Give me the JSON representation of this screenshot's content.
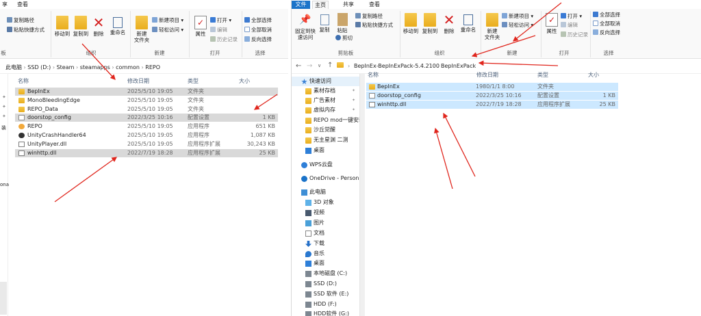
{
  "colors": {
    "accent": "#1a73c9",
    "selection": "#cce8ff",
    "selection_grey": "#d9d9d9",
    "arrow": "#e0261d",
    "folder": "#f0bc3a"
  },
  "left_window": {
    "tabs": [
      "享",
      "查看"
    ],
    "ribbon": {
      "copy_path": "复制路径",
      "paste_shortcut": "粘贴快捷方式",
      "move_to": "移动到",
      "copy_to": "复制到",
      "delete": "删除",
      "rename": "重命名",
      "new_folder": "新建\n文件夹",
      "new_item": "新建项目",
      "easy_access": "轻松访问",
      "properties": "属性",
      "open": "打开",
      "edit": "编辑",
      "history": "历史记录",
      "select_all": "全部选择",
      "select_none": "全部取消",
      "invert_selection": "反向选择",
      "group_clipboard": "板",
      "group_organize": "组织",
      "group_new": "新建",
      "group_open": "打开",
      "group_select": "选择"
    },
    "breadcrumb": [
      "此电脑",
      "SSD (D:)",
      "Steam",
      "steamapps",
      "common",
      "REPO"
    ],
    "columns": [
      "名称",
      "修改日期",
      "类型",
      "大小"
    ],
    "files": [
      {
        "name": "BepInEx",
        "date": "2025/5/10 19:05",
        "type": "文件夹",
        "size": "",
        "icon": "folder-icon",
        "selected": true
      },
      {
        "name": "MonoBleedingEdge",
        "date": "2025/5/10 19:05",
        "type": "文件夹",
        "size": "",
        "icon": "folder-icon",
        "selected": false
      },
      {
        "name": "REPO_Data",
        "date": "2025/5/10 19:05",
        "type": "文件夹",
        "size": "",
        "icon": "folder-icon",
        "selected": false
      },
      {
        "name": "doorstop_config",
        "date": "2022/3/25 10:16",
        "type": "配置设置",
        "size": "1 KB",
        "icon": "config-file-icon",
        "selected": true
      },
      {
        "name": "REPO",
        "date": "2025/5/10 19:05",
        "type": "应用程序",
        "size": "651 KB",
        "icon": "app-icon",
        "selected": false
      },
      {
        "name": "UnityCrashHandler64",
        "date": "2025/5/10 19:05",
        "type": "应用程序",
        "size": "1,087 KB",
        "icon": "unity-icon",
        "selected": false
      },
      {
        "name": "UnityPlayer.dll",
        "date": "2025/5/10 19:05",
        "type": "应用程序扩展",
        "size": "30,243 KB",
        "icon": "dll-icon",
        "selected": false
      },
      {
        "name": "winhttp.dll",
        "date": "2022/7/19 18:28",
        "type": "应用程序扩展",
        "size": "25 KB",
        "icon": "dll-icon",
        "selected": true
      }
    ],
    "nav_fragments": [
      "装",
      "ona"
    ]
  },
  "right_window": {
    "tabs": [
      "文件",
      "主页",
      "共享",
      "查看"
    ],
    "active_tab": "主页",
    "ribbon": {
      "pin_quick": "固定到快\n速访问",
      "copy": "复制",
      "paste": "粘贴",
      "copy_path": "复制路径",
      "paste_shortcut": "粘贴快捷方式",
      "cut": "剪切",
      "move_to": "移动到",
      "copy_to": "复制到",
      "delete": "删除",
      "rename": "重命名",
      "new_folder": "新建\n文件夹",
      "new_item": "新建项目",
      "easy_access": "轻松访问",
      "properties": "属性",
      "open": "打开",
      "edit": "编辑",
      "history": "历史记录",
      "select_all": "全部选择",
      "select_none": "全部取消",
      "invert_selection": "反向选择",
      "group_clipboard": "剪贴板",
      "group_organize": "组织",
      "group_new": "新建",
      "group_open": "打开",
      "group_select": "选择"
    },
    "breadcrumb": [
      "BepInEx-BepInExPack-5.4.2100",
      "BepInExPack"
    ],
    "columns": [
      "名称",
      "修改日期",
      "类型",
      "大小"
    ],
    "files": [
      {
        "name": "BepInEx",
        "date": "1980/1/1 8:00",
        "type": "文件夹",
        "size": "",
        "icon": "folder-icon"
      },
      {
        "name": "doorstop_config",
        "date": "2022/3/25 10:16",
        "type": "配置设置",
        "size": "1 KB",
        "icon": "config-file-icon"
      },
      {
        "name": "winhttp.dll",
        "date": "2022/7/19 18:28",
        "type": "应用程序扩展",
        "size": "25 KB",
        "icon": "dll-icon"
      }
    ],
    "nav": [
      {
        "label": "快速访问",
        "icon": "star-icon",
        "kind": "section",
        "pinned": false
      },
      {
        "label": "素材存档",
        "icon": "folder-icon",
        "kind": "item",
        "pinned": true
      },
      {
        "label": "广告素材",
        "icon": "folder-icon",
        "kind": "item",
        "pinned": true
      },
      {
        "label": "虚拟内存",
        "icon": "folder-icon",
        "kind": "item",
        "pinned": true
      },
      {
        "label": "REPO mod一键安装",
        "icon": "folder-icon",
        "kind": "item",
        "pinned": false
      },
      {
        "label": "沙丘觉醒",
        "icon": "folder-icon",
        "kind": "item",
        "pinned": false
      },
      {
        "label": "无主星渊 二测",
        "icon": "folder-icon",
        "kind": "item",
        "pinned": false
      },
      {
        "label": "桌面",
        "icon": "desktop-icon",
        "kind": "item",
        "pinned": false
      },
      {
        "label": "WPS云盘",
        "icon": "cloud-icon",
        "kind": "section",
        "pinned": false
      },
      {
        "label": "OneDrive - Persona",
        "icon": "onedrive-icon",
        "kind": "section",
        "pinned": false
      },
      {
        "label": "此电脑",
        "icon": "computer-icon",
        "kind": "section",
        "pinned": false
      },
      {
        "label": "3D 对象",
        "icon": "3d-icon",
        "kind": "item",
        "pinned": false
      },
      {
        "label": "视频",
        "icon": "video-icon",
        "kind": "item",
        "pinned": false
      },
      {
        "label": "图片",
        "icon": "picture-icon",
        "kind": "item",
        "pinned": false
      },
      {
        "label": "文档",
        "icon": "document-icon",
        "kind": "item",
        "pinned": false
      },
      {
        "label": "下载",
        "icon": "download-icon",
        "kind": "item",
        "pinned": false
      },
      {
        "label": "音乐",
        "icon": "music-icon",
        "kind": "item",
        "pinned": false
      },
      {
        "label": "桌面",
        "icon": "desktop-icon",
        "kind": "item",
        "pinned": false
      },
      {
        "label": "本地磁盘 (C:)",
        "icon": "drive-icon",
        "kind": "item",
        "pinned": false
      },
      {
        "label": "SSD (D:)",
        "icon": "drive-icon",
        "kind": "item",
        "pinned": false
      },
      {
        "label": "SSD 软件 (E:)",
        "icon": "drive-icon",
        "kind": "item",
        "pinned": false
      },
      {
        "label": "HDD (F:)",
        "icon": "drive-icon",
        "kind": "item",
        "pinned": false
      },
      {
        "label": "HDD软件 (G:)",
        "icon": "drive-icon",
        "kind": "item",
        "pinned": false
      }
    ]
  }
}
